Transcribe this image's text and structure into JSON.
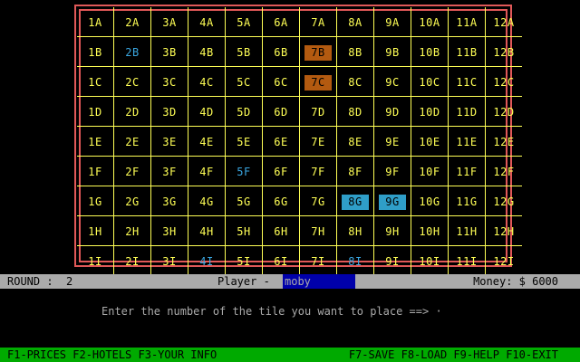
{
  "board": {
    "rows": [
      [
        {
          "label": "1A",
          "state": "normal"
        },
        {
          "label": "2A",
          "state": "normal"
        },
        {
          "label": "3A",
          "state": "normal"
        },
        {
          "label": "4A",
          "state": "normal"
        },
        {
          "label": "5A",
          "state": "normal"
        },
        {
          "label": "6A",
          "state": "normal"
        },
        {
          "label": "7A",
          "state": "normal"
        },
        {
          "label": "8A",
          "state": "normal"
        },
        {
          "label": "9A",
          "state": "normal"
        },
        {
          "label": "10A",
          "state": "normal"
        },
        {
          "label": "11A",
          "state": "normal"
        },
        {
          "label": "12A",
          "state": "normal"
        }
      ],
      [
        {
          "label": "1B",
          "state": "normal"
        },
        {
          "label": "2B",
          "state": "blue"
        },
        {
          "label": "3B",
          "state": "normal"
        },
        {
          "label": "4B",
          "state": "normal"
        },
        {
          "label": "5B",
          "state": "normal"
        },
        {
          "label": "6B",
          "state": "normal"
        },
        {
          "label": "7B",
          "state": "owned-brown"
        },
        {
          "label": "8B",
          "state": "normal"
        },
        {
          "label": "9B",
          "state": "normal"
        },
        {
          "label": "10B",
          "state": "normal"
        },
        {
          "label": "11B",
          "state": "normal"
        },
        {
          "label": "12B",
          "state": "normal"
        }
      ],
      [
        {
          "label": "1C",
          "state": "normal"
        },
        {
          "label": "2C",
          "state": "normal"
        },
        {
          "label": "3C",
          "state": "normal"
        },
        {
          "label": "4C",
          "state": "normal"
        },
        {
          "label": "5C",
          "state": "normal"
        },
        {
          "label": "6C",
          "state": "normal"
        },
        {
          "label": "7C",
          "state": "owned-brown"
        },
        {
          "label": "8C",
          "state": "normal"
        },
        {
          "label": "9C",
          "state": "normal"
        },
        {
          "label": "10C",
          "state": "normal"
        },
        {
          "label": "11C",
          "state": "normal"
        },
        {
          "label": "12C",
          "state": "normal"
        }
      ],
      [
        {
          "label": "1D",
          "state": "normal"
        },
        {
          "label": "2D",
          "state": "normal"
        },
        {
          "label": "3D",
          "state": "normal"
        },
        {
          "label": "4D",
          "state": "normal"
        },
        {
          "label": "5D",
          "state": "normal"
        },
        {
          "label": "6D",
          "state": "normal"
        },
        {
          "label": "7D",
          "state": "normal"
        },
        {
          "label": "8D",
          "state": "normal"
        },
        {
          "label": "9D",
          "state": "normal"
        },
        {
          "label": "10D",
          "state": "normal"
        },
        {
          "label": "11D",
          "state": "normal"
        },
        {
          "label": "12D",
          "state": "normal"
        }
      ],
      [
        {
          "label": "1E",
          "state": "normal"
        },
        {
          "label": "2E",
          "state": "normal"
        },
        {
          "label": "3E",
          "state": "normal"
        },
        {
          "label": "4E",
          "state": "normal"
        },
        {
          "label": "5E",
          "state": "normal"
        },
        {
          "label": "6E",
          "state": "normal"
        },
        {
          "label": "7E",
          "state": "normal"
        },
        {
          "label": "8E",
          "state": "normal"
        },
        {
          "label": "9E",
          "state": "normal"
        },
        {
          "label": "10E",
          "state": "normal"
        },
        {
          "label": "11E",
          "state": "normal"
        },
        {
          "label": "12E",
          "state": "normal"
        }
      ],
      [
        {
          "label": "1F",
          "state": "normal"
        },
        {
          "label": "2F",
          "state": "normal"
        },
        {
          "label": "3F",
          "state": "normal"
        },
        {
          "label": "4F",
          "state": "normal"
        },
        {
          "label": "5F",
          "state": "blue"
        },
        {
          "label": "6F",
          "state": "normal"
        },
        {
          "label": "7F",
          "state": "normal"
        },
        {
          "label": "8F",
          "state": "normal"
        },
        {
          "label": "9F",
          "state": "normal"
        },
        {
          "label": "10F",
          "state": "normal"
        },
        {
          "label": "11F",
          "state": "normal"
        },
        {
          "label": "12F",
          "state": "normal"
        }
      ],
      [
        {
          "label": "1G",
          "state": "normal"
        },
        {
          "label": "2G",
          "state": "normal"
        },
        {
          "label": "3G",
          "state": "normal"
        },
        {
          "label": "4G",
          "state": "normal"
        },
        {
          "label": "5G",
          "state": "normal"
        },
        {
          "label": "6G",
          "state": "normal"
        },
        {
          "label": "7G",
          "state": "normal"
        },
        {
          "label": "8G",
          "state": "owned-cyan"
        },
        {
          "label": "9G",
          "state": "owned-cyan"
        },
        {
          "label": "10G",
          "state": "normal"
        },
        {
          "label": "11G",
          "state": "normal"
        },
        {
          "label": "12G",
          "state": "normal"
        }
      ],
      [
        {
          "label": "1H",
          "state": "normal"
        },
        {
          "label": "2H",
          "state": "normal"
        },
        {
          "label": "3H",
          "state": "normal"
        },
        {
          "label": "4H",
          "state": "normal"
        },
        {
          "label": "5H",
          "state": "normal"
        },
        {
          "label": "6H",
          "state": "normal"
        },
        {
          "label": "7H",
          "state": "normal"
        },
        {
          "label": "8H",
          "state": "normal"
        },
        {
          "label": "9H",
          "state": "normal"
        },
        {
          "label": "10H",
          "state": "normal"
        },
        {
          "label": "11H",
          "state": "normal"
        },
        {
          "label": "12H",
          "state": "normal"
        }
      ],
      [
        {
          "label": "1I",
          "state": "normal"
        },
        {
          "label": "2I",
          "state": "normal"
        },
        {
          "label": "3I",
          "state": "normal"
        },
        {
          "label": "4I",
          "state": "blue"
        },
        {
          "label": "5I",
          "state": "normal"
        },
        {
          "label": "6I",
          "state": "normal"
        },
        {
          "label": "7I",
          "state": "normal"
        },
        {
          "label": "8I",
          "state": "blue"
        },
        {
          "label": "9I",
          "state": "normal"
        },
        {
          "label": "10I",
          "state": "normal"
        },
        {
          "label": "11I",
          "state": "normal"
        },
        {
          "label": "12I",
          "state": "normal"
        }
      ]
    ]
  },
  "status": {
    "round_text": "ROUND :  2",
    "player_label": "Player -",
    "player_name": "moby",
    "money_text": "Money: $ 6000"
  },
  "prompt": {
    "text": "Enter the number of the tile you want to place ==> ",
    "cursor": "·"
  },
  "function_keys": {
    "left": "F1-PRICES F2-HOTELS F3-YOUR INFO",
    "right": "F7-SAVE F8-LOAD F9-HELP F10-EXIT"
  },
  "colors": {
    "grid": "#ffff55",
    "frame": "#e05858",
    "tile_text": "#ffff55",
    "tile_blue": "#3aa6e0",
    "owned_brown": "#b35a10",
    "owned_cyan": "#2f9ec8",
    "status_bar": "#aaaaaa",
    "player_highlight": "#0000aa",
    "fkey_bar": "#00aa00"
  }
}
